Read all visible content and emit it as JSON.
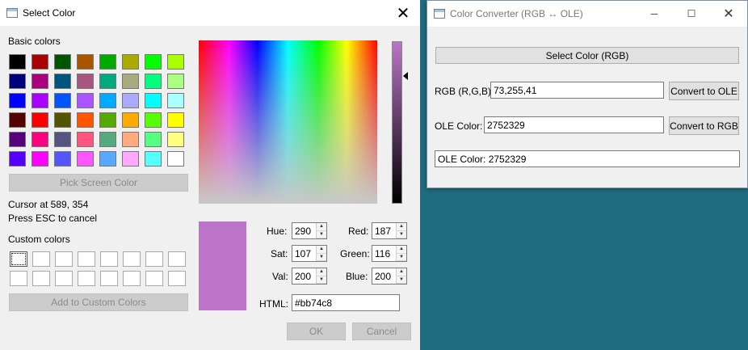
{
  "dialog": {
    "title": "Select Color",
    "close_glyph": "✕",
    "basic_colors_label": "Basic colors",
    "basic_colors": [
      [
        "#000000",
        "#aa0000",
        "#005500",
        "#aa5500",
        "#00aa00",
        "#aaaa00",
        "#00ff00",
        "#aaff00"
      ],
      [
        "#00007f",
        "#aa007f",
        "#00557f",
        "#aa557f",
        "#00aa7f",
        "#aaaa7f",
        "#00ff7f",
        "#aaff7f"
      ],
      [
        "#0000ff",
        "#aa00ff",
        "#0055ff",
        "#aa55ff",
        "#00aaff",
        "#aaaaff",
        "#00ffff",
        "#aaffff"
      ],
      [
        "#550000",
        "#ff0000",
        "#555500",
        "#ff5500",
        "#55aa00",
        "#ffaa00",
        "#55ff00",
        "#ffff00"
      ],
      [
        "#55007f",
        "#ff007f",
        "#55557f",
        "#ff557f",
        "#55aa7f",
        "#ffaa7f",
        "#55ff7f",
        "#ffff7f"
      ],
      [
        "#5500ff",
        "#ff00ff",
        "#5555ff",
        "#ff55ff",
        "#55aaff",
        "#ffaaff",
        "#55ffff",
        "#ffffff"
      ]
    ],
    "pick_screen_label": "Pick Screen Color",
    "cursor_text": "Cursor at 589, 354",
    "esc_text": "Press ESC to cancel",
    "custom_colors_label": "Custom colors",
    "add_custom_label": "Add to Custom Colors",
    "preview_color": "#bb74c8",
    "hue_label": "Hue:",
    "hue": "290",
    "sat_label": "Sat:",
    "sat": "107",
    "val_label": "Val:",
    "val": "200",
    "red_label": "Red:",
    "red": "187",
    "green_label": "Green:",
    "green": "116",
    "blue_label": "Blue:",
    "blue": "200",
    "html_label": "HTML:",
    "html": "#bb74c8",
    "ok_label": "OK",
    "cancel_label": "Cancel"
  },
  "converter": {
    "title": "Color Converter (RGB ↔ OLE)",
    "minimize_glyph": "─",
    "maximize_glyph": "☐",
    "close_glyph": "✕",
    "select_color_label": "Select Color (RGB)",
    "rgb_label": "RGB (R,G,B):",
    "rgb_value": "73,255,41",
    "to_ole_label": "Convert to OLE",
    "ole_label": "OLE Color:",
    "ole_value": "2752329",
    "to_rgb_label": "Convert to RGB",
    "result_text": "OLE Color: 2752329"
  }
}
